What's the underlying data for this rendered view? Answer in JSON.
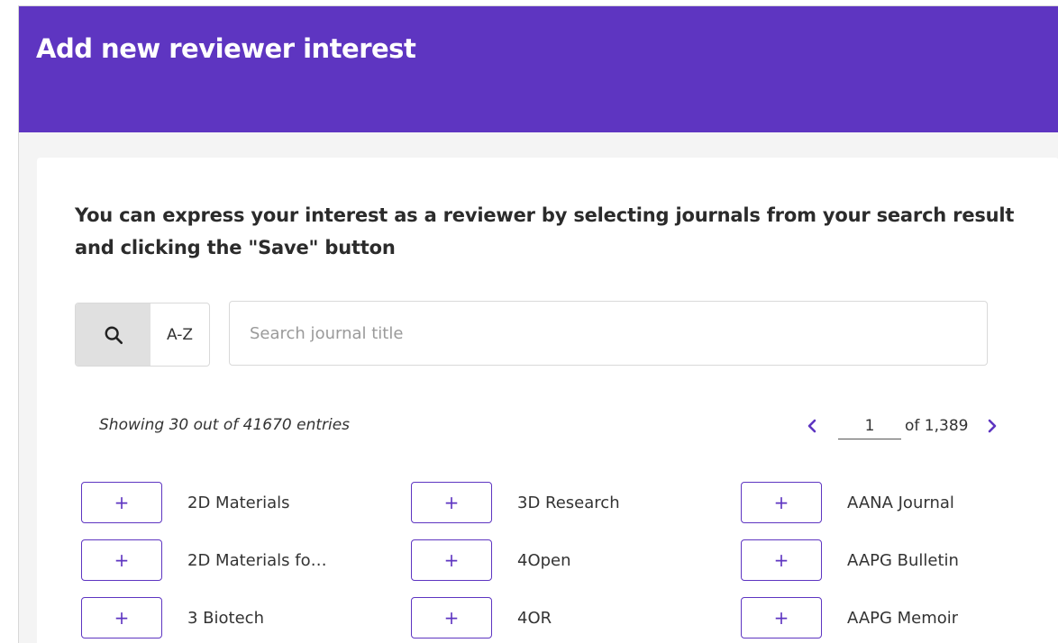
{
  "header": {
    "title": "Add new reviewer interest"
  },
  "intro": "You can express your interest as a reviewer by selecting journals from your search result and clicking the \"Save\" button",
  "search": {
    "az_label": "A-Z",
    "placeholder": "Search journal title"
  },
  "results": {
    "showing_text": "Showing 30 out of 41670 entries"
  },
  "pagination": {
    "current_page": "1",
    "of_text": "of 1,389"
  },
  "journals": {
    "add_label": "+",
    "items": [
      "2D Materials",
      "3D Research",
      "AANA Journal",
      "2D Materials fo…",
      "4Open",
      "AAPG Bulletin",
      "3 Biotech",
      "4OR",
      "AAPG Memoir"
    ]
  },
  "colors": {
    "brand": "#5e35c1"
  }
}
